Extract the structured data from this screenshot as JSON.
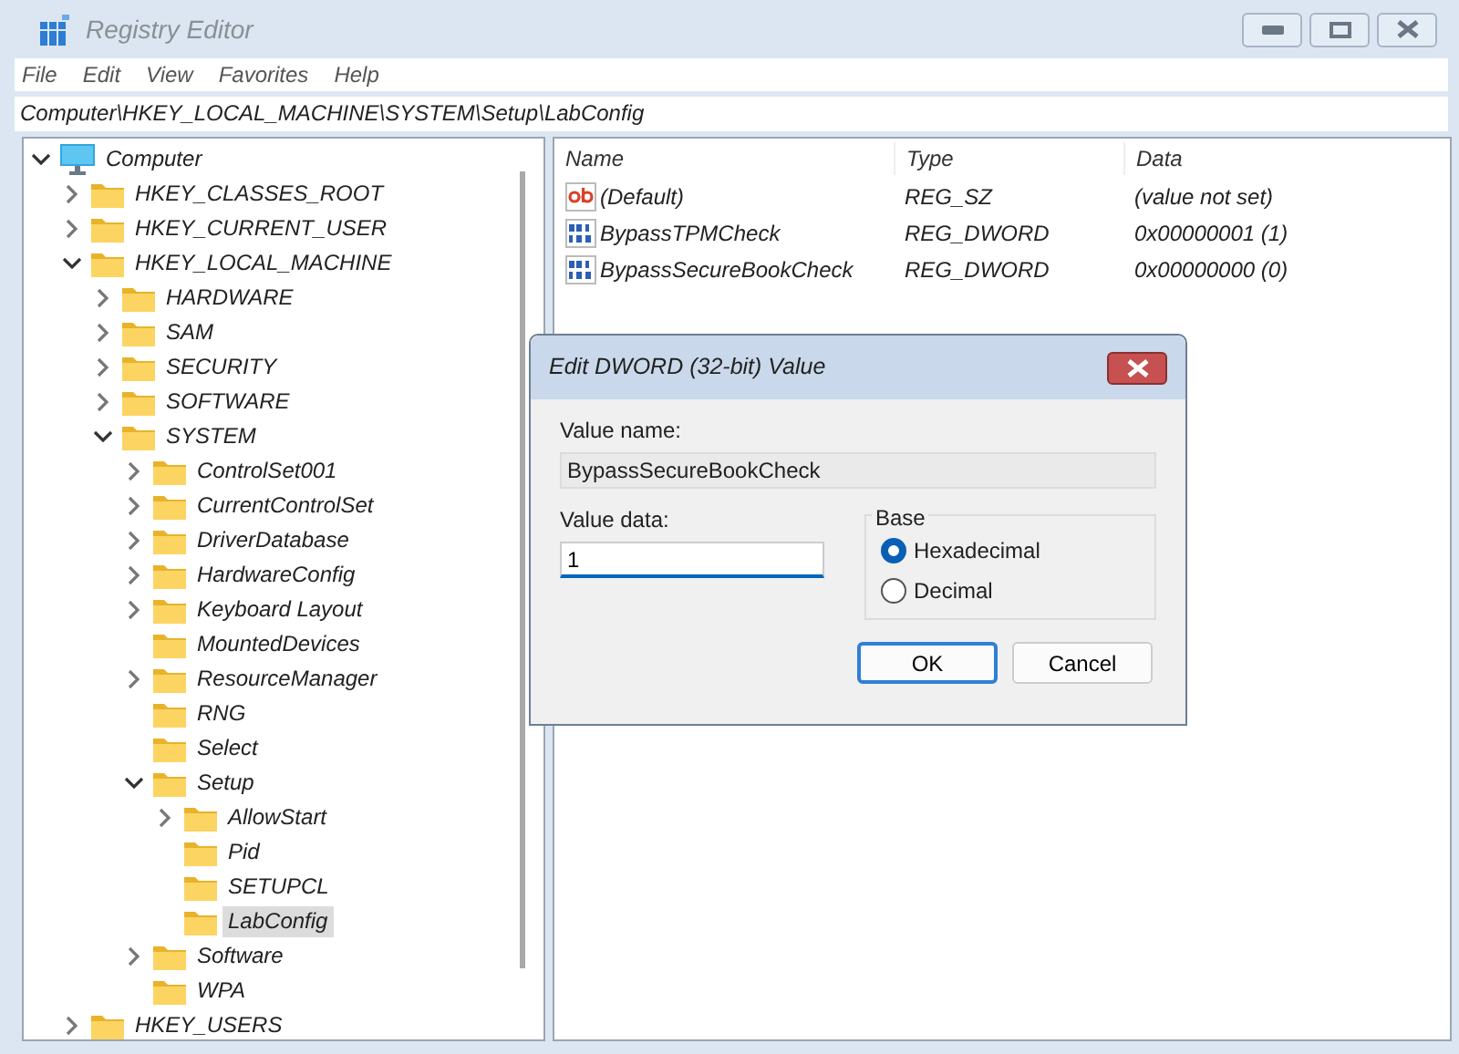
{
  "window": {
    "title": "Registry Editor"
  },
  "menu": [
    "File",
    "Edit",
    "View",
    "Favorites",
    "Help"
  ],
  "address": "Computer\\HKEY_LOCAL_MACHINE\\SYSTEM\\Setup\\LabConfig",
  "tree": [
    {
      "label": "Computer",
      "kind": "computer",
      "expanded": true,
      "selected": false,
      "children": [
        {
          "label": "HKEY_CLASSES_ROOT",
          "kind": "folder",
          "expanded": false,
          "selected": false
        },
        {
          "label": "HKEY_CURRENT_USER",
          "kind": "folder",
          "expanded": false,
          "selected": false
        },
        {
          "label": "HKEY_LOCAL_MACHINE",
          "kind": "folder",
          "expanded": true,
          "selected": false,
          "children": [
            {
              "label": "HARDWARE",
              "kind": "folder",
              "expanded": false,
              "selected": false
            },
            {
              "label": "SAM",
              "kind": "folder",
              "expanded": false,
              "selected": false
            },
            {
              "label": "SECURITY",
              "kind": "folder",
              "expanded": false,
              "selected": false
            },
            {
              "label": "SOFTWARE",
              "kind": "folder",
              "expanded": false,
              "selected": false
            },
            {
              "label": "SYSTEM",
              "kind": "folder",
              "expanded": true,
              "selected": false,
              "children": [
                {
                  "label": "ControlSet001",
                  "kind": "folder",
                  "expanded": false,
                  "selected": false
                },
                {
                  "label": "CurrentControlSet",
                  "kind": "folder",
                  "expanded": false,
                  "selected": false
                },
                {
                  "label": "DriverDatabase",
                  "kind": "folder",
                  "expanded": false,
                  "selected": false
                },
                {
                  "label": "HardwareConfig",
                  "kind": "folder",
                  "expanded": false,
                  "selected": false
                },
                {
                  "label": "Keyboard Layout",
                  "kind": "folder",
                  "expanded": false,
                  "selected": false
                },
                {
                  "label": "MountedDevices",
                  "kind": "folder",
                  "selected": false
                },
                {
                  "label": "ResourceManager",
                  "kind": "folder",
                  "expanded": false,
                  "selected": false
                },
                {
                  "label": "RNG",
                  "kind": "folder",
                  "selected": false
                },
                {
                  "label": "Select",
                  "kind": "folder",
                  "selected": false
                },
                {
                  "label": "Setup",
                  "kind": "folder",
                  "expanded": true,
                  "selected": false,
                  "children": [
                    {
                      "label": "AllowStart",
                      "kind": "folder",
                      "expanded": false,
                      "selected": false
                    },
                    {
                      "label": "Pid",
                      "kind": "folder",
                      "selected": false
                    },
                    {
                      "label": "SETUPCL",
                      "kind": "folder",
                      "selected": false
                    },
                    {
                      "label": "LabConfig",
                      "kind": "folder",
                      "selected": true
                    }
                  ]
                },
                {
                  "label": "Software",
                  "kind": "folder",
                  "expanded": false,
                  "selected": false
                },
                {
                  "label": "WPA",
                  "kind": "folder",
                  "selected": false
                }
              ]
            }
          ]
        },
        {
          "label": "HKEY_USERS",
          "kind": "folder",
          "expanded": false,
          "selected": false
        }
      ]
    }
  ],
  "values": {
    "columns": [
      "Name",
      "Type",
      "Data"
    ],
    "rows": [
      {
        "kind": "string",
        "name": "(Default)",
        "type": "REG_SZ",
        "data": "(value not set)"
      },
      {
        "kind": "dword",
        "name": "BypassTPMCheck",
        "type": "REG_DWORD",
        "data": "0x00000001 (1)"
      },
      {
        "kind": "dword",
        "name": "BypassSecureBookCheck",
        "type": "REG_DWORD",
        "data": "0x00000000 (0)"
      }
    ]
  },
  "dialog": {
    "title": "Edit DWORD (32-bit) Value",
    "name_label": "Value name:",
    "name_value": "BypassSecureBookCheck",
    "data_label": "Value data:",
    "data_value": "1",
    "base_label": "Base",
    "base_options": [
      {
        "label": "Hexadecimal",
        "selected": true
      },
      {
        "label": "Decimal",
        "selected": false
      }
    ],
    "buttons": [
      {
        "label": "OK",
        "default": true
      },
      {
        "label": "Cancel",
        "default": false
      }
    ]
  }
}
